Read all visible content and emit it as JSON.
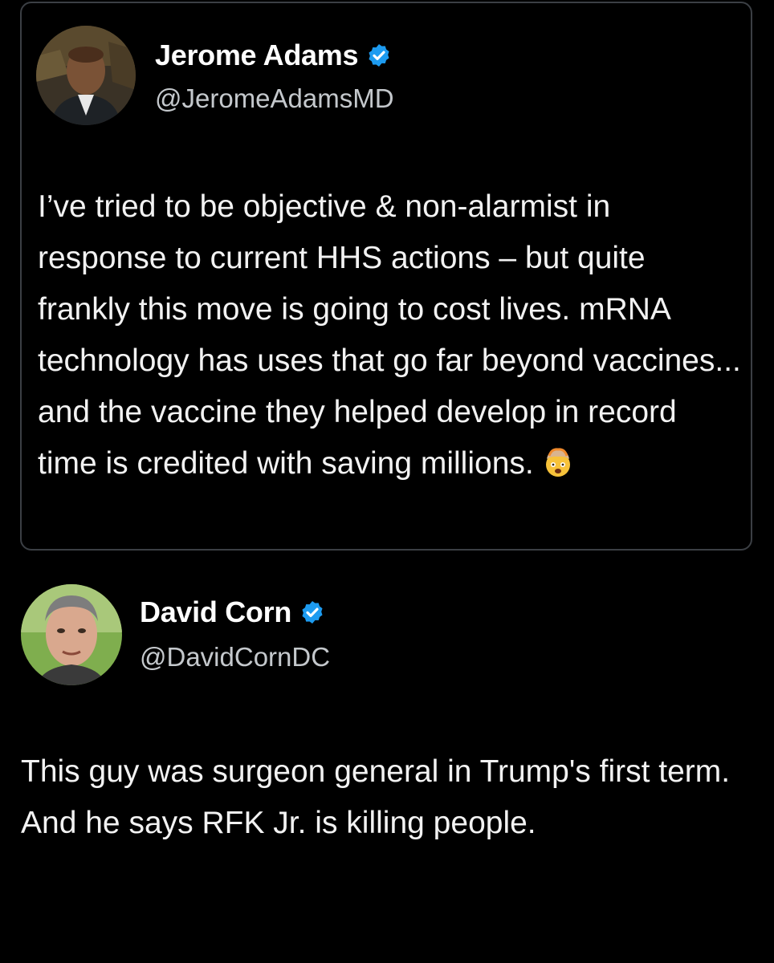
{
  "quoted_tweet": {
    "author_name": "Jerome Adams",
    "author_handle": "@JeromeAdamsMD",
    "verified": true,
    "body": "I’ve tried to be objective & non-alarmist in response to current HHS actions – but quite frankly this move is going to cost lives. mRNA technology has uses that go far beyond vaccines... and the vaccine they helped develop in record time is credited with saving millions.",
    "emoji": "exploding-head-icon"
  },
  "main_tweet": {
    "author_name": "David Corn",
    "author_handle": "@DavidCornDC",
    "verified": true,
    "body": "This guy was surgeon general in Trump's first term. And he says RFK Jr. is killing people."
  },
  "colors": {
    "background": "#000000",
    "text": "#f2f2f2",
    "handle": "#c4c8cc",
    "card_border": "#3b3f44",
    "verified_badge": "#1d9bf0"
  }
}
